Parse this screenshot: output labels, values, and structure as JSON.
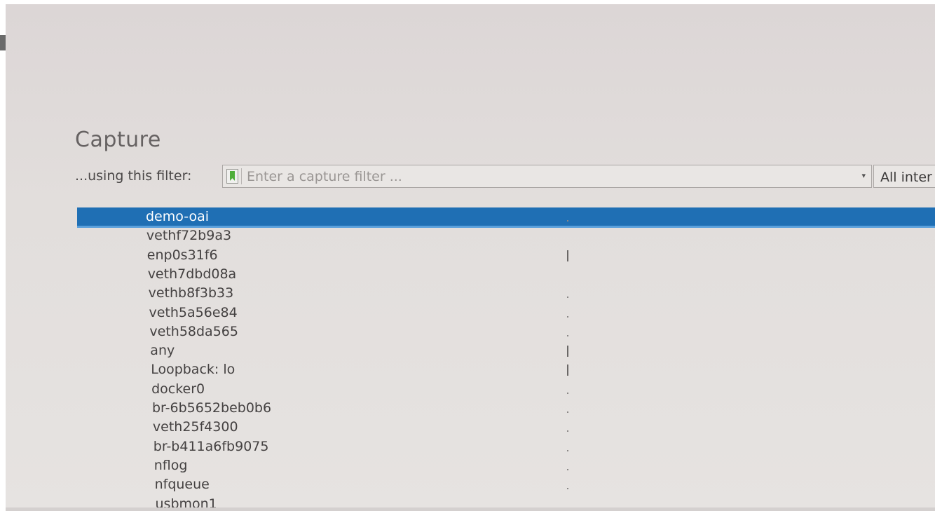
{
  "capture": {
    "title": "Capture",
    "filter_label": "...using this filter:",
    "filter_placeholder": "Enter a capture filter ...",
    "interfaces_dropdown_label": "All inter"
  },
  "interfaces": [
    {
      "name": "demo-oai",
      "selected": true,
      "activity": "flat"
    },
    {
      "name": "vethf72b9a3",
      "selected": false,
      "activity": "none"
    },
    {
      "name": "enp0s31f6",
      "selected": false,
      "activity": "spike"
    },
    {
      "name": "veth7dbd08a",
      "selected": false,
      "activity": "none"
    },
    {
      "name": "vethb8f3b33",
      "selected": false,
      "activity": "flat"
    },
    {
      "name": "veth5a56e84",
      "selected": false,
      "activity": "flat"
    },
    {
      "name": "veth58da565",
      "selected": false,
      "activity": "flat"
    },
    {
      "name": "any",
      "selected": false,
      "activity": "spike"
    },
    {
      "name": "Loopback: lo",
      "selected": false,
      "activity": "spike"
    },
    {
      "name": "docker0",
      "selected": false,
      "activity": "flat"
    },
    {
      "name": "br-6b5652beb0b6",
      "selected": false,
      "activity": "flat"
    },
    {
      "name": "veth25f4300",
      "selected": false,
      "activity": "flat"
    },
    {
      "name": "br-b411a6fb9075",
      "selected": false,
      "activity": "flat"
    },
    {
      "name": "nflog",
      "selected": false,
      "activity": "flat"
    },
    {
      "name": "nfqueue",
      "selected": false,
      "activity": "flat"
    },
    {
      "name": "usbmon1",
      "selected": false,
      "activity": "none"
    }
  ],
  "colors": {
    "selection": "#1f6fb4",
    "filter_bookmark": "#4fae3a"
  },
  "icons": {
    "bookmark": "bookmark-icon",
    "dropdown": "chevron-down-icon"
  }
}
